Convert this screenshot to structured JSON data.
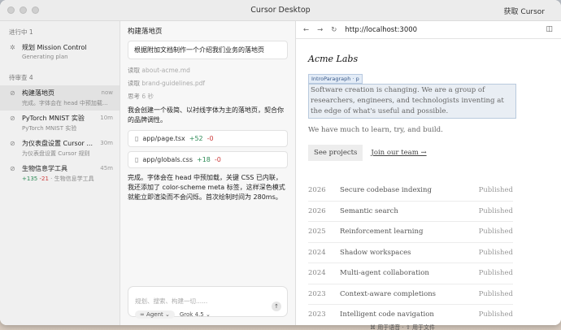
{
  "window": {
    "title": "Cursor Desktop",
    "get_cursor": "获取 Cursor"
  },
  "sidebar": {
    "in_progress_label": "进行中 1",
    "in_progress": [
      {
        "title": "规划 Mission Control",
        "subtitle": "Generating plan"
      }
    ],
    "review_label": "待审查 4",
    "review": [
      {
        "title": "构建落地页",
        "subtitle": "完成。字体会在 head 中预加载...",
        "time": "now"
      },
      {
        "title": "PyTorch MNIST 实验",
        "subtitle": "PyTorch MNIST 实验",
        "time": "10m"
      },
      {
        "title": "为仪表盘设置 Cursor ...",
        "subtitle": "为仪表盘设置 Cursor 规则",
        "time": "30m"
      },
      {
        "title": "生物信息学工具",
        "plus": "+135",
        "minus": "-21",
        "subtitle": "· 生物信息学工具",
        "time": "45m"
      }
    ]
  },
  "chat": {
    "title": "构建落地页",
    "prompt": "根据附加文档制作一个介绍我们业务的落地页",
    "steps": [
      {
        "verb": "读取",
        "name": "about-acme.md"
      },
      {
        "verb": "读取",
        "name": "brand-guidelines.pdf"
      },
      {
        "verb": "思考",
        "name": "6 秒"
      }
    ],
    "message1": "我会创建一个极简、以衬线字体为主的落地页，契合你的品牌调性。",
    "files": [
      {
        "name": "app/page.tsx",
        "plus": "+52",
        "minus": "-0"
      },
      {
        "name": "app/globals.css",
        "plus": "+18",
        "minus": "-0"
      }
    ],
    "message2": "完成。字体会在 head 中预加载，关键 CSS 已内联，我还添加了 color-scheme meta 标签，这样深色模式就能立即渲染而不会闪烁。首次绘制时间为 280ms。",
    "composer": {
      "placeholder": "规划、搜索、构建一切......",
      "agent": "∞ Agent ⌄",
      "model": "Grok 4.5 ⌄",
      "send": "↑"
    }
  },
  "browser": {
    "url": "http://localhost:3000",
    "site": {
      "name": "Acme Labs",
      "tag": "IntroParagraph · p",
      "intro": "Software creation is changing. We are a group of researchers, engineers, and technologists inventing at the edge of what's useful and possible.",
      "sub": "We have much to learn, try, and build.",
      "projects_button": "See projects",
      "team_link": "Join our team →",
      "projects": [
        {
          "year": "2026",
          "title": "Secure codebase indexing",
          "status": "Published"
        },
        {
          "year": "2026",
          "title": "Semantic search",
          "status": "Published"
        },
        {
          "year": "2025",
          "title": "Reinforcement learning",
          "status": "Published"
        },
        {
          "year": "2024",
          "title": "Shadow workspaces",
          "status": "Published"
        },
        {
          "year": "2024",
          "title": "Multi-agent collaboration",
          "status": "Published"
        },
        {
          "year": "2023",
          "title": "Context-aware completions",
          "status": "Published"
        },
        {
          "year": "2023",
          "title": "Intelligent code navigation",
          "status": "Published"
        }
      ]
    }
  },
  "footer_hint": "⌘ 用于语音 · ⇧ 用于文件"
}
